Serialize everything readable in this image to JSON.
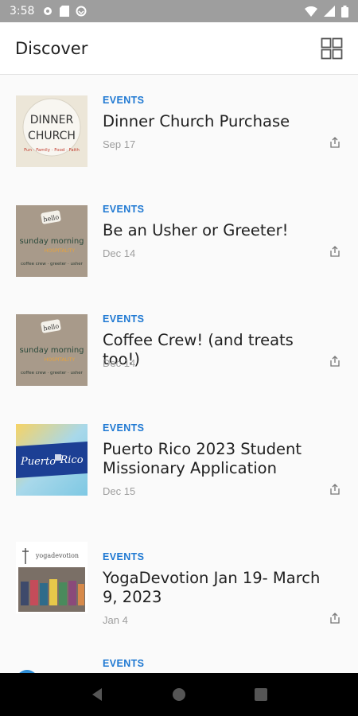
{
  "status_bar": {
    "time": "3:58"
  },
  "app_bar": {
    "title": "Discover"
  },
  "items": [
    {
      "category": "EVENTS",
      "title": "Dinner Church Purchase",
      "date": "Sep 17",
      "thumb": {
        "line1": "DINNER",
        "line2": "CHURCH",
        "tagline": "Fun · Family · Food · Faith"
      }
    },
    {
      "category": "EVENTS",
      "title": "Be an Usher or Greeter!",
      "date": "Dec 14",
      "thumb": {
        "badge": "hello",
        "line1": "sunday morning",
        "line2": "HOSPITALITY",
        "tagline": "coffee crew · greeter · usher"
      }
    },
    {
      "category": "EVENTS",
      "title": "Coffee Crew! (and treats too!)",
      "date": "Dec 14",
      "thumb": {
        "badge": "hello",
        "line1": "sunday morning",
        "line2": "HOSPITALITY",
        "tagline": "coffee crew · greeter · usher"
      }
    },
    {
      "category": "EVENTS",
      "title": "Puerto Rico 2023 Student Missionary Application",
      "date": "Dec 15",
      "thumb": {
        "line1": "Puerto",
        "line2": "Rico"
      }
    },
    {
      "category": "EVENTS",
      "title": "YogaDevotion Jan 19- March 9, 2023",
      "date": "Jan 4",
      "thumb": {
        "line1": "yogadevotion"
      }
    },
    {
      "category": "EVENTS"
    }
  ]
}
